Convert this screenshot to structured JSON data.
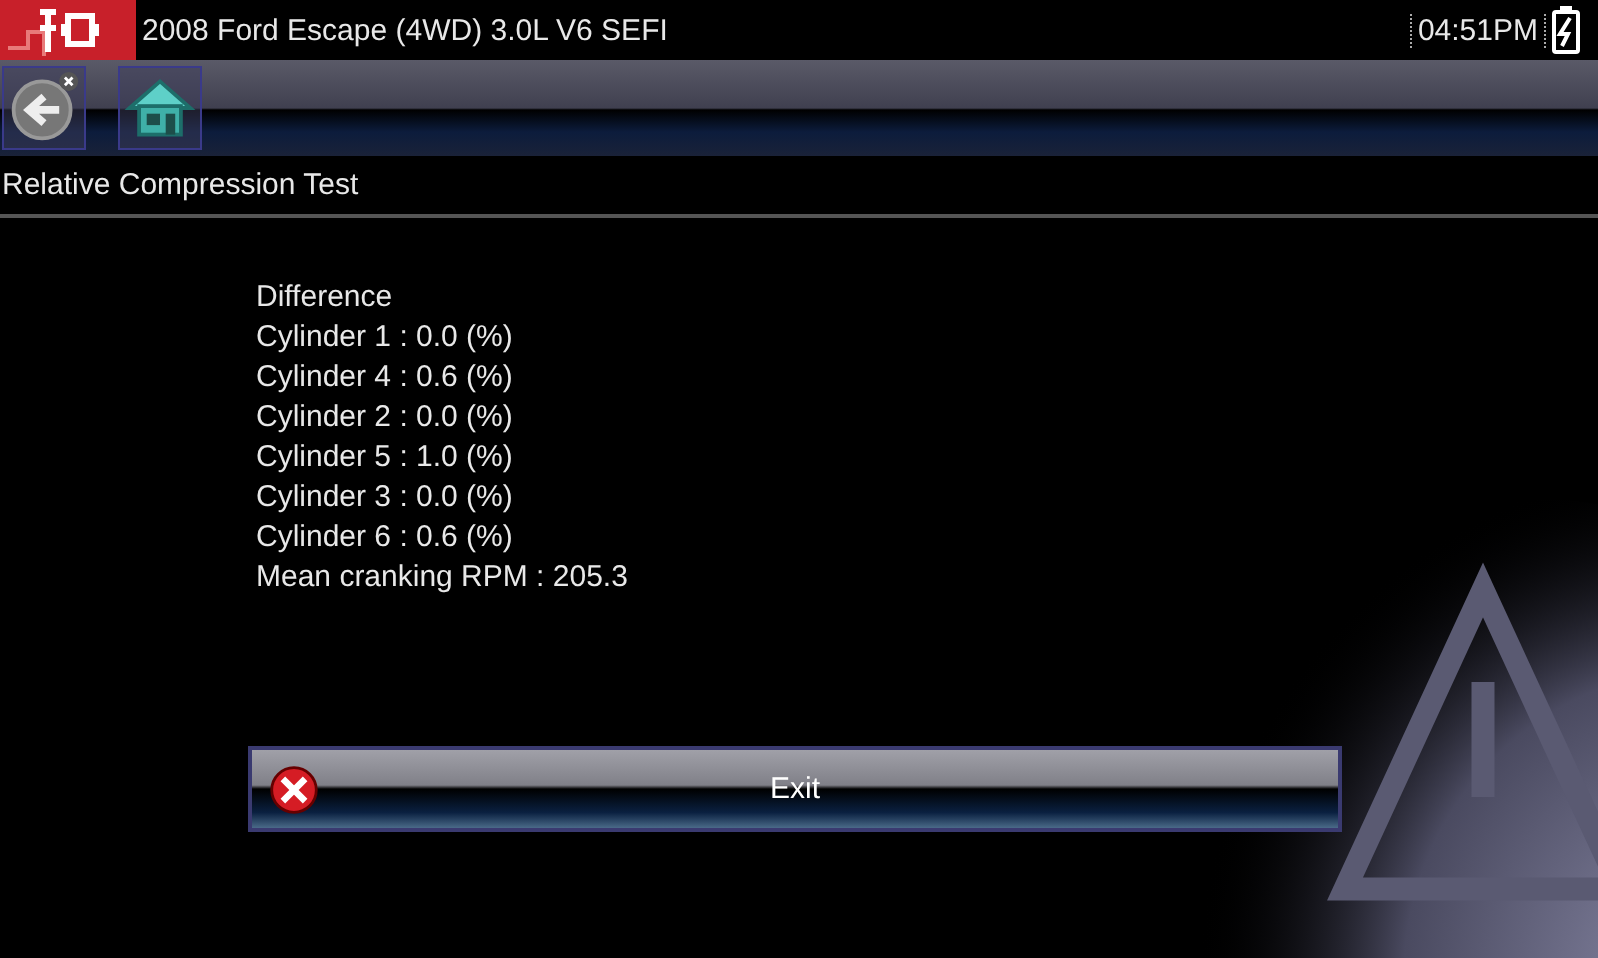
{
  "header": {
    "title": "2008 Ford Escape (4WD) 3.0L V6 SEFI",
    "time": "04:51PM"
  },
  "page_title": "Relative Compression Test",
  "results": [
    "Difference",
    "Cylinder 1 : 0.0 (%)",
    "Cylinder 4 : 0.6 (%)",
    "Cylinder 2 : 0.0 (%)",
    "Cylinder 5 : 1.0 (%)",
    "Cylinder 3 : 0.0 (%)",
    "Cylinder 6 : 0.6 (%)",
    "Mean cranking RPM : 205.3"
  ],
  "buttons": [
    {
      "label": "Exit"
    }
  ]
}
